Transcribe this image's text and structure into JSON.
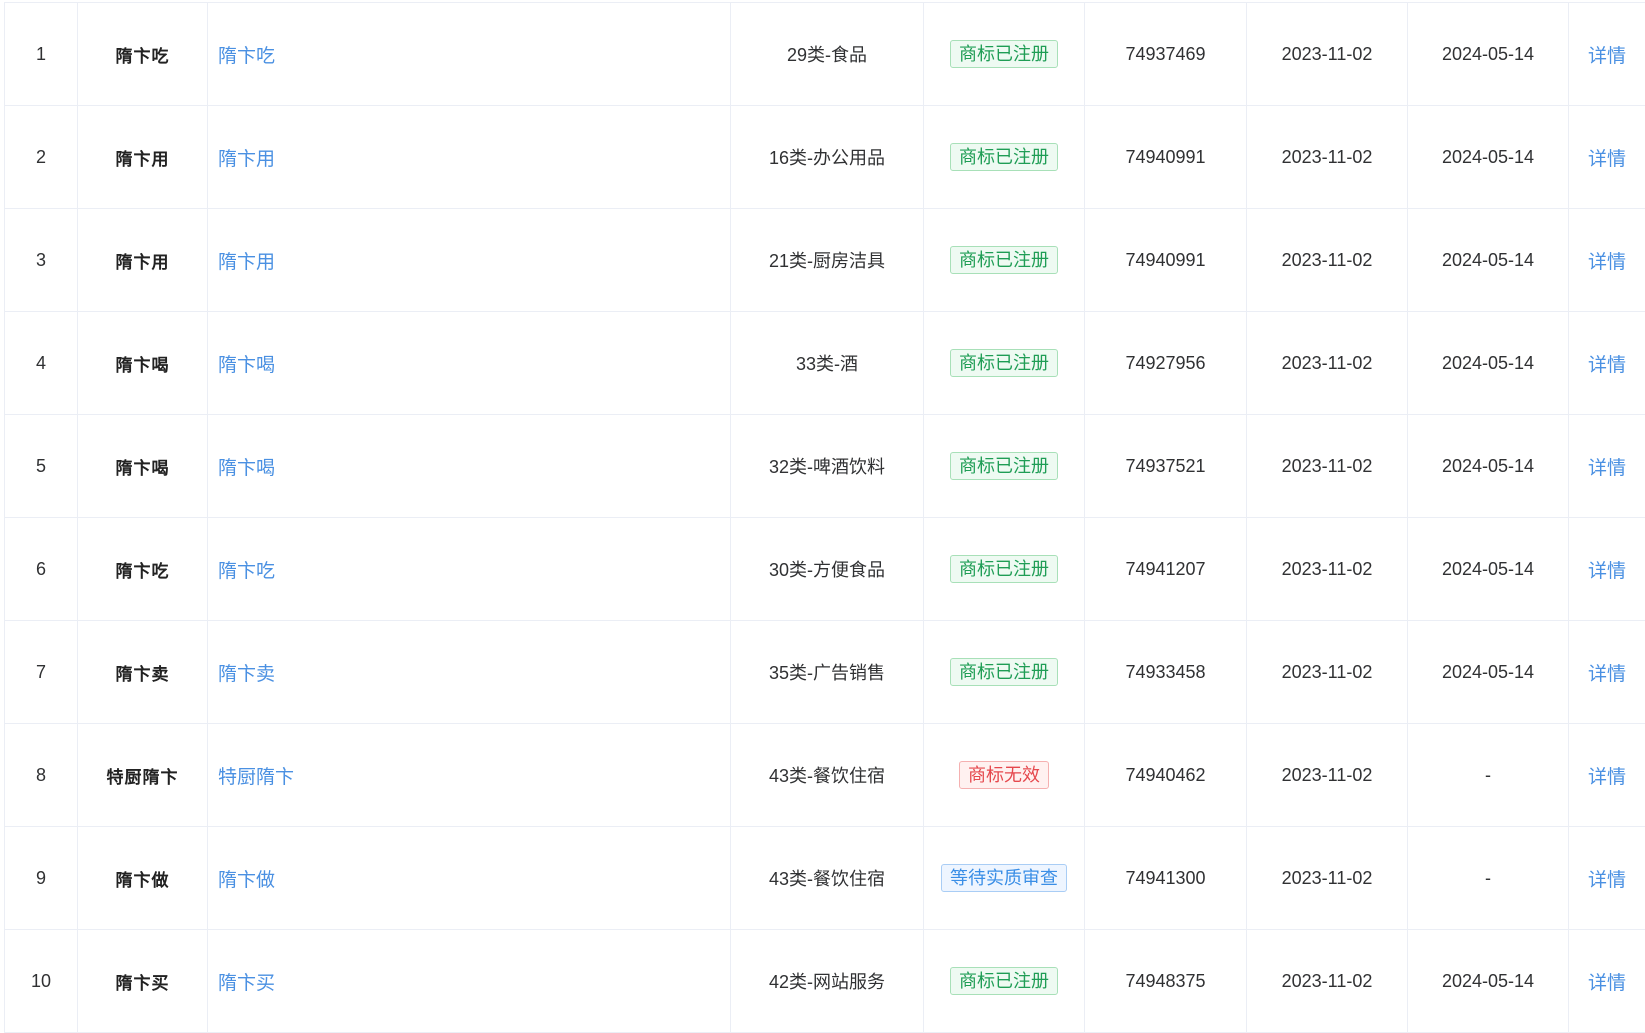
{
  "table": {
    "rows": [
      {
        "index": "1",
        "thumb": "隋卞吃",
        "name": "隋卞吃",
        "category": "29类-食品",
        "status": "商标已注册",
        "status_color": "green",
        "reg_no": "74937469",
        "apply_date": "2023-11-02",
        "reg_date": "2024-05-14",
        "action": "详情"
      },
      {
        "index": "2",
        "thumb": "隋卞用",
        "name": "隋卞用",
        "category": "16类-办公用品",
        "status": "商标已注册",
        "status_color": "green",
        "reg_no": "74940991",
        "apply_date": "2023-11-02",
        "reg_date": "2024-05-14",
        "action": "详情"
      },
      {
        "index": "3",
        "thumb": "隋卞用",
        "name": "隋卞用",
        "category": "21类-厨房洁具",
        "status": "商标已注册",
        "status_color": "green",
        "reg_no": "74940991",
        "apply_date": "2023-11-02",
        "reg_date": "2024-05-14",
        "action": "详情"
      },
      {
        "index": "4",
        "thumb": "隋卞喝",
        "name": "隋卞喝",
        "category": "33类-酒",
        "status": "商标已注册",
        "status_color": "green",
        "reg_no": "74927956",
        "apply_date": "2023-11-02",
        "reg_date": "2024-05-14",
        "action": "详情"
      },
      {
        "index": "5",
        "thumb": "隋卞喝",
        "name": "隋卞喝",
        "category": "32类-啤酒饮料",
        "status": "商标已注册",
        "status_color": "green",
        "reg_no": "74937521",
        "apply_date": "2023-11-02",
        "reg_date": "2024-05-14",
        "action": "详情"
      },
      {
        "index": "6",
        "thumb": "隋卞吃",
        "name": "隋卞吃",
        "category": "30类-方便食品",
        "status": "商标已注册",
        "status_color": "green",
        "reg_no": "74941207",
        "apply_date": "2023-11-02",
        "reg_date": "2024-05-14",
        "action": "详情"
      },
      {
        "index": "7",
        "thumb": "隋卞卖",
        "name": "隋卞卖",
        "category": "35类-广告销售",
        "status": "商标已注册",
        "status_color": "green",
        "reg_no": "74933458",
        "apply_date": "2023-11-02",
        "reg_date": "2024-05-14",
        "action": "详情"
      },
      {
        "index": "8",
        "thumb": "特厨隋卞",
        "name": "特厨隋卞",
        "category": "43类-餐饮住宿",
        "status": "商标无效",
        "status_color": "red",
        "reg_no": "74940462",
        "apply_date": "2023-11-02",
        "reg_date": "-",
        "action": "详情"
      },
      {
        "index": "9",
        "thumb": "隋卞做",
        "name": "隋卞做",
        "category": "43类-餐饮住宿",
        "status": "等待实质审查",
        "status_color": "blue",
        "reg_no": "74941300",
        "apply_date": "2023-11-02",
        "reg_date": "-",
        "action": "详情"
      },
      {
        "index": "10",
        "thumb": "隋卞买",
        "name": "隋卞买",
        "category": "42类-网站服务",
        "status": "商标已注册",
        "status_color": "green",
        "reg_no": "74948375",
        "apply_date": "2023-11-02",
        "reg_date": "2024-05-14",
        "action": "详情"
      }
    ]
  }
}
